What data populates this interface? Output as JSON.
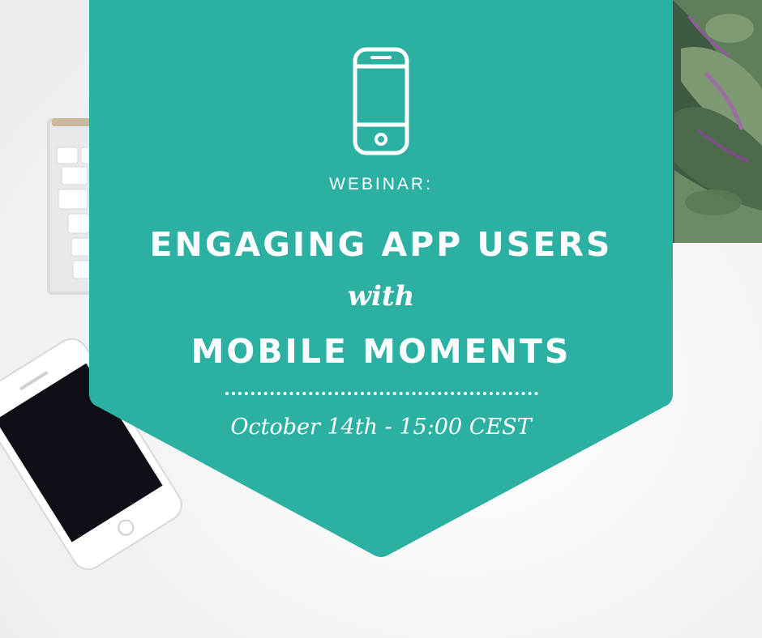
{
  "banner": {
    "kicker": "WEBINAR:",
    "title_line_1": "ENGAGING APP USERS",
    "connector": "with",
    "title_line_2": "MOBILE MOMENTS",
    "date_time": "October 14th - 15:00 CEST",
    "icon": "smartphone-icon"
  },
  "colors": {
    "banner": "#2bb0a2",
    "text": "#ffffff",
    "background": "#f3f3f5"
  }
}
